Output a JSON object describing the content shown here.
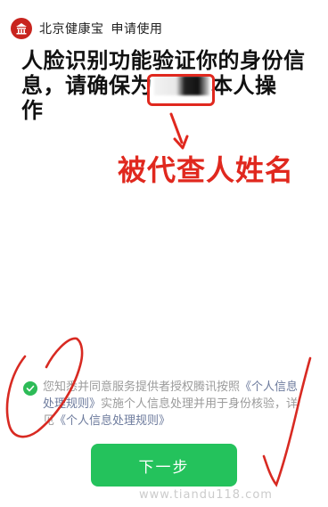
{
  "header": {
    "app_name": "北京健康宝",
    "subtitle": "申请使用"
  },
  "title": {
    "line1": "人脸识别功能验证你的身份信",
    "line2_before": "息，请确保为",
    "line2_after": "本人操",
    "line3": "作"
  },
  "annotation": {
    "label": "被代查人姓名",
    "color": "#e0281e"
  },
  "consent": {
    "text_part1": "您知悉并同意服务提供者授权腾讯按照",
    "link1": "《个人信息处理规则》",
    "text_part2": "实施个人信息处理并用于身份核验，详见",
    "link2": "《个人信息处理规则》",
    "checked": true
  },
  "next_button": {
    "label": "下一步",
    "color": "#24c25c"
  },
  "watermark": {
    "text": "www.tiandu118.com"
  },
  "colors": {
    "brand_red": "#c8241e",
    "check_green": "#2dbb57"
  }
}
